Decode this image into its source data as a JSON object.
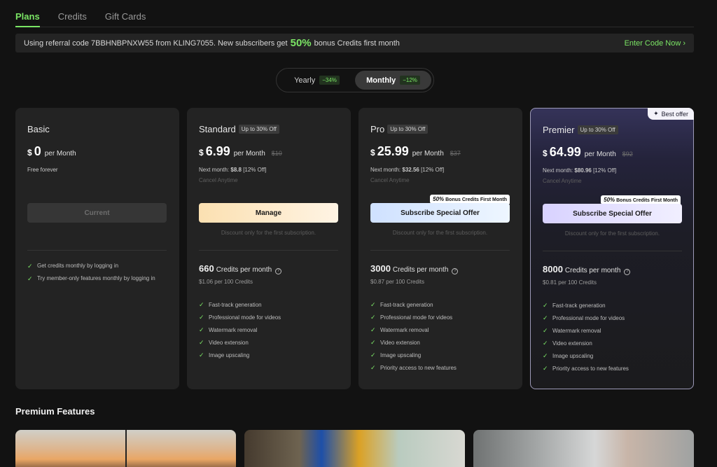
{
  "tabs": [
    "Plans",
    "Credits",
    "Gift Cards"
  ],
  "banner": {
    "text_before": "Using referral code 7BBHNBPNXW55 from KLING7055. New subscribers get",
    "pct": "50%",
    "text_after": "bonus Credits first month",
    "cta": "Enter Code Now ›"
  },
  "toggle": {
    "yearly": "Yearly",
    "yearly_badge": "−34%",
    "monthly": "Monthly",
    "monthly_badge": "−12%"
  },
  "plans": {
    "basic": {
      "name": "Basic",
      "currency": "$",
      "amount": "0",
      "per": "per Month",
      "sub1": "Free forever",
      "button": "Current",
      "features": [
        "Get credits monthly by logging in",
        "Try member-only features monthly by logging in"
      ]
    },
    "standard": {
      "name": "Standard",
      "tag": "Up to 30% Off",
      "currency": "$",
      "amount": "6.99",
      "per": "per Month",
      "old": "$10",
      "next_label": "Next month:",
      "next_price": "$8.8",
      "next_off": "[12% Off]",
      "sub2": "Cancel Anytime",
      "button": "Manage",
      "note": "Discount only for the first subscription.",
      "credits": "660",
      "credits_label": "Credits per month",
      "per100": "$1.06 per 100 Credits",
      "features": [
        "Fast-track generation",
        "Professional mode for videos",
        "Watermark removal",
        "Video extension",
        "Image upscaling"
      ]
    },
    "pro": {
      "name": "Pro",
      "tag": "Up to 30% Off",
      "currency": "$",
      "amount": "25.99",
      "per": "per Month",
      "old": "$37",
      "next_label": "Next month:",
      "next_price": "$32.56",
      "next_off": "[12% Off]",
      "sub2": "Cancel Anytime",
      "bonus_pct": "50%",
      "bonus_text": "Bonus Credits First Month",
      "button": "Subscribe Special Offer",
      "note": "Discount only for the first subscription.",
      "credits": "3000",
      "credits_label": "Credits per month",
      "per100": "$0.87 per 100 Credits",
      "features": [
        "Fast-track generation",
        "Professional mode for videos",
        "Watermark removal",
        "Video extension",
        "Image upscaling",
        "Priority access to new features"
      ]
    },
    "premier": {
      "name": "Premier",
      "tag": "Up to 30% Off",
      "best": "Best offer",
      "currency": "$",
      "amount": "64.99",
      "per": "per Month",
      "old": "$92",
      "next_label": "Next month:",
      "next_price": "$80.96",
      "next_off": "[12% Off]",
      "sub2": "Cancel Anytime",
      "bonus_pct": "50%",
      "bonus_text": "Bonus Credits First Month",
      "button": "Subscribe Special Offer",
      "note": "Discount only for the first subscription.",
      "credits": "8000",
      "credits_label": "Credits per month",
      "per100": "$0.81 per 100 Credits",
      "features": [
        "Fast-track generation",
        "Professional mode for videos",
        "Watermark removal",
        "Video extension",
        "Image upscaling",
        "Priority access to new features"
      ]
    }
  },
  "premium_title": "Premium Features",
  "colors": {
    "accent": "#7be565",
    "bg": "#121212",
    "card": "#232323"
  }
}
